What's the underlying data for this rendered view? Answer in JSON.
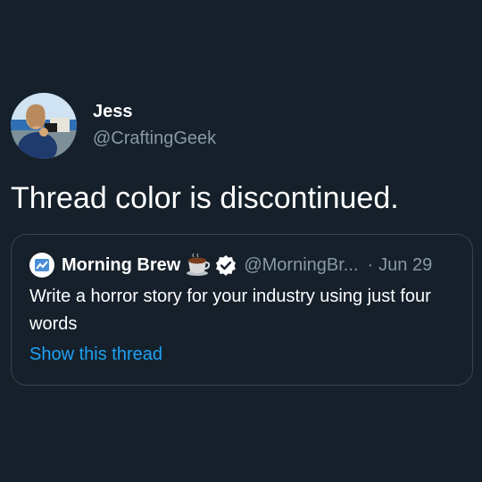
{
  "tweet": {
    "author_name": "Jess",
    "author_handle": "@CraftingGeek",
    "text": "Thread color is discontinued.",
    "avatar_icon": "user-avatar-photo"
  },
  "quoted_tweet": {
    "author_name": "Morning Brew",
    "author_handle": "@MorningBr...",
    "separator": "·",
    "date": "Jun 29",
    "text": "Write a horror story for your industry using just four words",
    "show_thread_label": "Show this thread",
    "logo_icon": "morning-brew-logo-icon",
    "emoji_icon": "coffee-cup-emoji-icon",
    "verified_icon": "verified-badge-icon"
  },
  "colors": {
    "background": "#15202b",
    "primary_text": "#ffffff",
    "secondary_text": "#8899a6",
    "link": "#1da1f2",
    "border": "#38444d"
  }
}
